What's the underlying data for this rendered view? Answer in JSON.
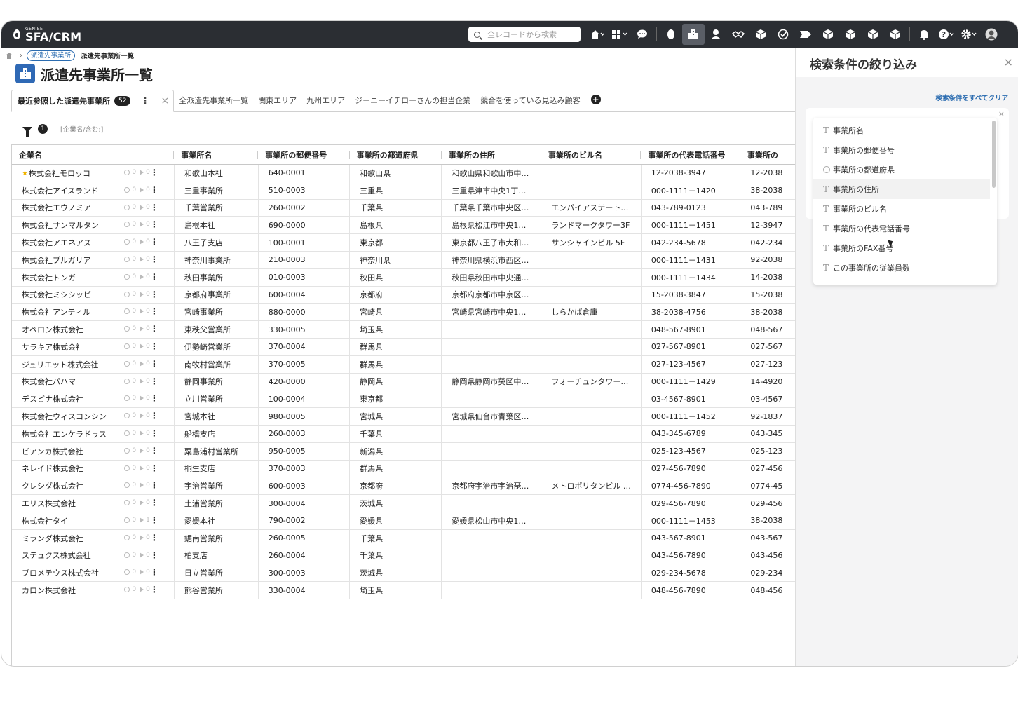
{
  "app": {
    "brand_small": "GENIEE",
    "brand_big": "SFA/CRM"
  },
  "search": {
    "placeholder": "全レコードから検索"
  },
  "breadcrumb": {
    "parent": "派遣先事業所",
    "current": "派遣先事業所一覧"
  },
  "page": {
    "title": "派遣先事業所一覧"
  },
  "tabs": {
    "active": {
      "label": "最近参照した派遣先事業所",
      "count": "52"
    },
    "others": [
      "全派遣先事業所一覧",
      "関東エリア",
      "九州エリア",
      "ジーニーイチローさんの担当企業",
      "競合を使っている見込み顧客"
    ]
  },
  "filter": {
    "count": "1",
    "text": "[企業名/含む:]"
  },
  "table": {
    "columns": [
      "企業名",
      "事業所名",
      "事業所の郵便番号",
      "事業所の都道府県",
      "事業所の住所",
      "事業所のビル名",
      "事業所の代表電話番号",
      "事業所の"
    ],
    "rows": [
      {
        "company": "株式会社モロッコ",
        "a": "0",
        "b": "0",
        "office": "和歌山本社",
        "zip": "640-0001",
        "pref": "和歌山県",
        "addr": "和歌山県和歌山市中…",
        "bldg": "",
        "tel": "12-2038-3947",
        "tel2": "12-2038"
      },
      {
        "company": "株式会社アイスランド",
        "a": "0",
        "b": "0",
        "office": "三重事業所",
        "zip": "510-0003",
        "pref": "三重県",
        "addr": "三重県津市中央1丁…",
        "bldg": "",
        "tel": "000-1111－1420",
        "tel2": "38-2038"
      },
      {
        "company": "株式会社エウノミア",
        "a": "0",
        "b": "0",
        "office": "千葉営業所",
        "zip": "260-0002",
        "pref": "千葉県",
        "addr": "千葉県千葉市中央区…",
        "bldg": "エンパイアステート…",
        "tel": "043-789-0123",
        "tel2": "043-789"
      },
      {
        "company": "株式会社サンマルタン",
        "a": "0",
        "b": "0",
        "office": "島根本社",
        "zip": "690-0000",
        "pref": "島根県",
        "addr": "島根県松江市中央1…",
        "bldg": "ランドマークタワー3F",
        "tel": "000-1111－1451",
        "tel2": "12-3947"
      },
      {
        "company": "株式会社アエネアス",
        "a": "0",
        "b": "0",
        "office": "八王子支店",
        "zip": "100-0001",
        "pref": "東京都",
        "addr": "東京都八王子市大和…",
        "bldg": "サンシャインビル 5F",
        "tel": "042-234-5678",
        "tel2": "042-234"
      },
      {
        "company": "株式会社ブルガリア",
        "a": "0",
        "b": "0",
        "office": "神奈川事業所",
        "zip": "210-0003",
        "pref": "神奈川県",
        "addr": "神奈川県横浜市西区…",
        "bldg": "",
        "tel": "000-1111－1431",
        "tel2": "92-2038"
      },
      {
        "company": "株式会社トンガ",
        "a": "0",
        "b": "0",
        "office": "秋田事業所",
        "zip": "010-0003",
        "pref": "秋田県",
        "addr": "秋田県秋田市中央通…",
        "bldg": "",
        "tel": "000-1111－1434",
        "tel2": "14-2038"
      },
      {
        "company": "株式会社ミシシッピ",
        "a": "0",
        "b": "0",
        "office": "京都府事業所",
        "zip": "600-0004",
        "pref": "京都府",
        "addr": "京都府京都市中京区…",
        "bldg": "",
        "tel": "15-2038-3847",
        "tel2": "15-2038"
      },
      {
        "company": "株式会社アンティル",
        "a": "0",
        "b": "0",
        "office": "宮崎事業所",
        "zip": "880-0000",
        "pref": "宮崎県",
        "addr": "宮崎県宮崎市中央1…",
        "bldg": "しらかば倉庫",
        "tel": "38-2038-4756",
        "tel2": "38-2038"
      },
      {
        "company": "オベロン株式会社",
        "a": "0",
        "b": "0",
        "office": "東秩父営業所",
        "zip": "330-0005",
        "pref": "埼玉県",
        "addr": "",
        "bldg": "",
        "tel": "048-567-8901",
        "tel2": "048-567"
      },
      {
        "company": "サラキア株式会社",
        "a": "0",
        "b": "0",
        "office": "伊勢崎営業所",
        "zip": "370-0004",
        "pref": "群馬県",
        "addr": "",
        "bldg": "",
        "tel": "027-567-8901",
        "tel2": "027-567"
      },
      {
        "company": "ジュリエット株式会社",
        "a": "0",
        "b": "0",
        "office": "南牧村営業所",
        "zip": "370-0005",
        "pref": "群馬県",
        "addr": "",
        "bldg": "",
        "tel": "027-123-4567",
        "tel2": "027-123"
      },
      {
        "company": "株式会社パハマ",
        "a": "0",
        "b": "0",
        "office": "静岡事業所",
        "zip": "420-0000",
        "pref": "静岡県",
        "addr": "静岡県静岡市葵区中…",
        "bldg": "フォーチュンタワー…",
        "tel": "000-1111－1429",
        "tel2": "14-4920"
      },
      {
        "company": "デスピナ株式会社",
        "a": "0",
        "b": "0",
        "office": "立川営業所",
        "zip": "100-0004",
        "pref": "東京都",
        "addr": "",
        "bldg": "",
        "tel": "03-4567-8901",
        "tel2": "03-4567"
      },
      {
        "company": "株式会社ウィスコンシン",
        "a": "0",
        "b": "0",
        "office": "宮城本社",
        "zip": "980-0005",
        "pref": "宮城県",
        "addr": "宮城県仙台市青葉区…",
        "bldg": "",
        "tel": "000-1111－1452",
        "tel2": "92-1837"
      },
      {
        "company": "株式会社エンケラドゥス",
        "a": "0",
        "b": "0",
        "office": "船橋支店",
        "zip": "260-0003",
        "pref": "千葉県",
        "addr": "",
        "bldg": "",
        "tel": "043-345-6789",
        "tel2": "043-345"
      },
      {
        "company": "ビアンカ株式会社",
        "a": "0",
        "b": "0",
        "office": "粟島浦村営業所",
        "zip": "950-0005",
        "pref": "新潟県",
        "addr": "",
        "bldg": "",
        "tel": "025-123-4567",
        "tel2": "025-123"
      },
      {
        "company": "ネレイド株式会社",
        "a": "0",
        "b": "0",
        "office": "桐生支店",
        "zip": "370-0003",
        "pref": "群馬県",
        "addr": "",
        "bldg": "",
        "tel": "027-456-7890",
        "tel2": "027-456"
      },
      {
        "company": "クレシダ株式会社",
        "a": "0",
        "b": "0",
        "office": "宇治営業所",
        "zip": "600-0003",
        "pref": "京都府",
        "addr": "京都府宇治市宇治琵…",
        "bldg": "メトロポリタンビル …",
        "tel": "0774-456-7890",
        "tel2": "0774-45"
      },
      {
        "company": "エリス株式会社",
        "a": "0",
        "b": "0",
        "office": "土浦営業所",
        "zip": "300-0004",
        "pref": "茨城県",
        "addr": "",
        "bldg": "",
        "tel": "029-456-7890",
        "tel2": "029-456"
      },
      {
        "company": "株式会社タイ",
        "a": "0",
        "b": "1",
        "office": "愛媛本社",
        "zip": "790-0002",
        "pref": "愛媛県",
        "addr": "愛媛県松山市中央1…",
        "bldg": "",
        "tel": "000-1111－1453",
        "tel2": "38-2038"
      },
      {
        "company": "ミランダ株式会社",
        "a": "0",
        "b": "0",
        "office": "鋸南営業所",
        "zip": "260-0005",
        "pref": "千葉県",
        "addr": "",
        "bldg": "",
        "tel": "043-567-8901",
        "tel2": "043-567"
      },
      {
        "company": "ステュクス株式会社",
        "a": "0",
        "b": "0",
        "office": "柏支店",
        "zip": "260-0004",
        "pref": "千葉県",
        "addr": "",
        "bldg": "",
        "tel": "043-456-7890",
        "tel2": "043-456"
      },
      {
        "company": "プロメテウス株式会社",
        "a": "0",
        "b": "0",
        "office": "日立営業所",
        "zip": "300-0003",
        "pref": "茨城県",
        "addr": "",
        "bldg": "",
        "tel": "029-234-5678",
        "tel2": "029-234"
      },
      {
        "company": "カロン株式会社",
        "a": "0",
        "b": "0",
        "office": "熊谷営業所",
        "zip": "330-0004",
        "pref": "埼玉県",
        "addr": "",
        "bldg": "",
        "tel": "048-456-7890",
        "tel2": "048-456"
      }
    ]
  },
  "panel": {
    "title": "検索条件の絞り込み",
    "clear_all": "検索条件をすべてクリア",
    "options": [
      {
        "type": "text",
        "label": "事業所名"
      },
      {
        "type": "text",
        "label": "事業所の郵便番号"
      },
      {
        "type": "check",
        "label": "事業所の都道府県"
      },
      {
        "type": "text",
        "label": "事業所の住所"
      },
      {
        "type": "text",
        "label": "事業所のビル名"
      },
      {
        "type": "text",
        "label": "事業所の代表電話番号"
      },
      {
        "type": "text",
        "label": "事業所のFAX番号"
      },
      {
        "type": "text",
        "label": "この事業所の従業員数"
      }
    ]
  },
  "colors": {
    "topbar": "#2b2e33",
    "accent": "#2f69b5",
    "link": "#2b6cb0"
  }
}
